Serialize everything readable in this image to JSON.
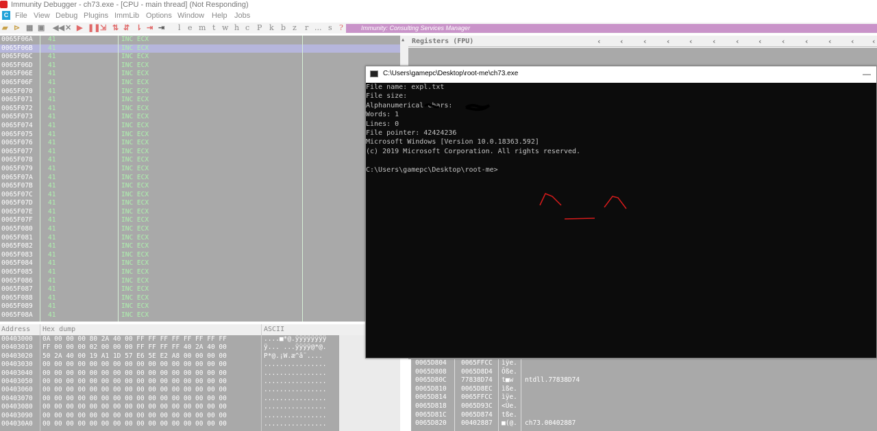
{
  "window": {
    "title": "Immunity Debugger - ch73.exe - [CPU - main thread] (Not Responding)"
  },
  "menu": {
    "c_box": "C",
    "items": [
      "File",
      "View",
      "Debug",
      "Plugins",
      "ImmLib",
      "Options",
      "Window",
      "Help",
      "Jobs"
    ]
  },
  "toolbar": {
    "letters": [
      "l",
      "e",
      "m",
      "t",
      "w",
      "h",
      "c",
      "P",
      "k",
      "b",
      "z",
      "r",
      "...",
      "s",
      "?"
    ],
    "strip_text": "Immunity: Consulting Services Manager"
  },
  "disasm": {
    "rows": [
      {
        "addr": "0065F06A",
        "hex": "41",
        "instr": "INC ECX"
      },
      {
        "addr": "0065F06B",
        "hex": "41",
        "instr": "INC ECX",
        "selected": true
      },
      {
        "addr": "0065F06C",
        "hex": "41",
        "instr": "INC ECX"
      },
      {
        "addr": "0065F06D",
        "hex": "41",
        "instr": "INC ECX"
      },
      {
        "addr": "0065F06E",
        "hex": "41",
        "instr": "INC ECX"
      },
      {
        "addr": "0065F06F",
        "hex": "41",
        "instr": "INC ECX"
      },
      {
        "addr": "0065F070",
        "hex": "41",
        "instr": "INC ECX"
      },
      {
        "addr": "0065F071",
        "hex": "41",
        "instr": "INC ECX"
      },
      {
        "addr": "0065F072",
        "hex": "41",
        "instr": "INC ECX"
      },
      {
        "addr": "0065F073",
        "hex": "41",
        "instr": "INC ECX"
      },
      {
        "addr": "0065F074",
        "hex": "41",
        "instr": "INC ECX"
      },
      {
        "addr": "0065F075",
        "hex": "41",
        "instr": "INC ECX"
      },
      {
        "addr": "0065F076",
        "hex": "41",
        "instr": "INC ECX"
      },
      {
        "addr": "0065F077",
        "hex": "41",
        "instr": "INC ECX"
      },
      {
        "addr": "0065F078",
        "hex": "41",
        "instr": "INC ECX"
      },
      {
        "addr": "0065F079",
        "hex": "41",
        "instr": "INC ECX"
      },
      {
        "addr": "0065F07A",
        "hex": "41",
        "instr": "INC ECX"
      },
      {
        "addr": "0065F07B",
        "hex": "41",
        "instr": "INC ECX"
      },
      {
        "addr": "0065F07C",
        "hex": "41",
        "instr": "INC ECX"
      },
      {
        "addr": "0065F07D",
        "hex": "41",
        "instr": "INC ECX"
      },
      {
        "addr": "0065F07E",
        "hex": "41",
        "instr": "INC ECX"
      },
      {
        "addr": "0065F07F",
        "hex": "41",
        "instr": "INC ECX"
      },
      {
        "addr": "0065F080",
        "hex": "41",
        "instr": "INC ECX"
      },
      {
        "addr": "0065F081",
        "hex": "41",
        "instr": "INC ECX"
      },
      {
        "addr": "0065F082",
        "hex": "41",
        "instr": "INC ECX"
      },
      {
        "addr": "0065F083",
        "hex": "41",
        "instr": "INC ECX"
      },
      {
        "addr": "0065F084",
        "hex": "41",
        "instr": "INC ECX"
      },
      {
        "addr": "0065F085",
        "hex": "41",
        "instr": "INC ECX"
      },
      {
        "addr": "0065F086",
        "hex": "41",
        "instr": "INC ECX"
      },
      {
        "addr": "0065F087",
        "hex": "41",
        "instr": "INC ECX"
      },
      {
        "addr": "0065F088",
        "hex": "41",
        "instr": "INC ECX"
      },
      {
        "addr": "0065F089",
        "hex": "41",
        "instr": "INC ECX"
      },
      {
        "addr": "0065F08A",
        "hex": "41",
        "instr": "INC ECX"
      }
    ]
  },
  "registers": {
    "header": "Registers (FPU)"
  },
  "dump": {
    "col_address": "Address",
    "col_hex": "Hex dump",
    "col_ascii": "ASCII",
    "rows": [
      {
        "addr": "00403000",
        "bytes": "0A 00 00 00 80 2A 40 00 FF FF FF FF FF FF FF FF",
        "ascii": "....■*@.ÿÿÿÿÿÿÿÿ"
      },
      {
        "addr": "00403010",
        "bytes": "FF 00 00 00 02 00 00 00 FF FF FF FF 40 2A 40 00",
        "ascii": "ÿ... ...ÿÿÿÿ@*@."
      },
      {
        "addr": "00403020",
        "bytes": "50 2A 40 00 19 A1 1D 57 E6 5E E2 A8 00 00 00 00",
        "ascii": "P*@.¡W.æ^â¨...."
      },
      {
        "addr": "00403030",
        "bytes": "00 00 00 00 00 00 00 00 00 00 00 00 00 00 00 00",
        "ascii": "................"
      },
      {
        "addr": "00403040",
        "bytes": "00 00 00 00 00 00 00 00 00 00 00 00 00 00 00 00",
        "ascii": "................"
      },
      {
        "addr": "00403050",
        "bytes": "00 00 00 00 00 00 00 00 00 00 00 00 00 00 00 00",
        "ascii": "................"
      },
      {
        "addr": "00403060",
        "bytes": "00 00 00 00 00 00 00 00 00 00 00 00 00 00 00 00",
        "ascii": "................"
      },
      {
        "addr": "00403070",
        "bytes": "00 00 00 00 00 00 00 00 00 00 00 00 00 00 00 00",
        "ascii": "................"
      },
      {
        "addr": "00403080",
        "bytes": "00 00 00 00 00 00 00 00 00 00 00 00 00 00 00 00",
        "ascii": "................"
      },
      {
        "addr": "00403090",
        "bytes": "00 00 00 00 00 00 00 00 00 00 00 00 00 00 00 00",
        "ascii": "................"
      },
      {
        "addr": "004030A0",
        "bytes": "00 00 00 00 00 00 00 00 00 00 00 00 00 00 00 00",
        "ascii": "................"
      }
    ]
  },
  "stack": {
    "rows": [
      {
        "addr": "0065D804",
        "val": "0065FFCC",
        "ascii": "ìÿe.",
        "comment": ""
      },
      {
        "addr": "0065D808",
        "val": "0065D8D4",
        "ascii": "Ôße.",
        "comment": ""
      },
      {
        "addr": "0065D80C",
        "val": "77838D74",
        "ascii": "t■w",
        "comment": "ntdll.77838D74"
      },
      {
        "addr": "0065D810",
        "val": "0065D8EC",
        "ascii": "ìße.",
        "comment": ""
      },
      {
        "addr": "0065D814",
        "val": "0065FFCC",
        "ascii": "ìÿe.",
        "comment": ""
      },
      {
        "addr": "0065D818",
        "val": "0065D93C",
        "ascii": "<Ùe.",
        "comment": ""
      },
      {
        "addr": "0065D81C",
        "val": "0065D874",
        "ascii": "tße.",
        "comment": ""
      },
      {
        "addr": "0065D820",
        "val": "00402887",
        "ascii": "■(@.",
        "comment": "ch73.00402887"
      }
    ]
  },
  "console": {
    "title": "C:\\Users\\gamepc\\Desktop\\root-me\\ch73.exe",
    "lines": [
      "File name: expl.txt",
      "File size:",
      "Alphanumerical chars:",
      "Words: 1",
      "Lines: 0",
      "File pointer: 42424236",
      "Microsoft Windows [Version 10.0.18363.592]",
      "(c) 2019 Microsoft Corporation. All rights reserved.",
      "",
      "C:\\Users\\gamepc\\Desktop\\root-me>"
    ]
  },
  "colors": {
    "panel_bg": "#a9a9a9",
    "selection": "#b6b6dc",
    "console_bg": "#0c0c0c",
    "strip": "#c993c9",
    "scribble": "#d81b1b"
  }
}
